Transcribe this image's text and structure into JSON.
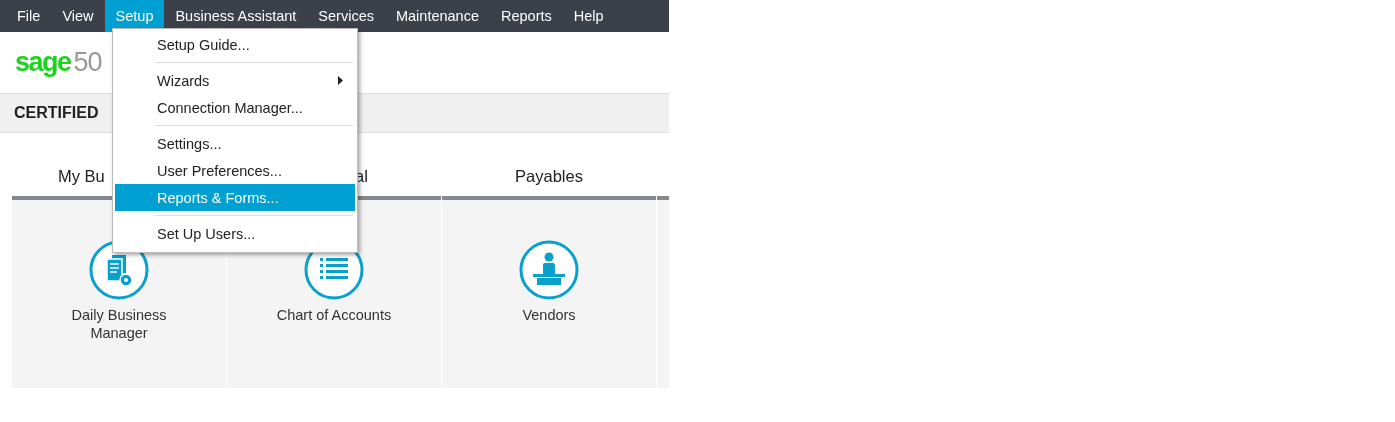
{
  "menu_bar": [
    {
      "label": "File",
      "selected": false
    },
    {
      "label": "View",
      "selected": false
    },
    {
      "label": "Setup",
      "selected": true
    },
    {
      "label": "Business Assistant",
      "selected": false
    },
    {
      "label": "Services",
      "selected": false
    },
    {
      "label": "Maintenance",
      "selected": false
    },
    {
      "label": "Reports",
      "selected": false
    },
    {
      "label": "Help",
      "selected": false
    }
  ],
  "logo": {
    "brand": "sage",
    "version": "50"
  },
  "banner": "CERTIFIED",
  "setup_menu": [
    {
      "kind": "item",
      "label": "Setup Guide...",
      "selected": false
    },
    {
      "kind": "separator"
    },
    {
      "kind": "submenu",
      "label": "Wizards",
      "selected": false
    },
    {
      "kind": "item",
      "label": "Connection Manager...",
      "selected": false
    },
    {
      "kind": "separator"
    },
    {
      "kind": "item",
      "label": "Settings...",
      "selected": false
    },
    {
      "kind": "item",
      "label": "User Preferences...",
      "selected": false
    },
    {
      "kind": "item",
      "label": "Reports & Forms...",
      "selected": true
    },
    {
      "kind": "separator"
    },
    {
      "kind": "item",
      "label": "Set Up Users...",
      "selected": false
    }
  ],
  "columns": [
    {
      "heading": "My Bu",
      "tile": {
        "label": "Daily Business Manager"
      }
    },
    {
      "heading": "al",
      "tile": {
        "label": "Chart of Accounts"
      }
    },
    {
      "heading": "Payables",
      "tile": {
        "label": "Vendors"
      }
    },
    {}
  ]
}
